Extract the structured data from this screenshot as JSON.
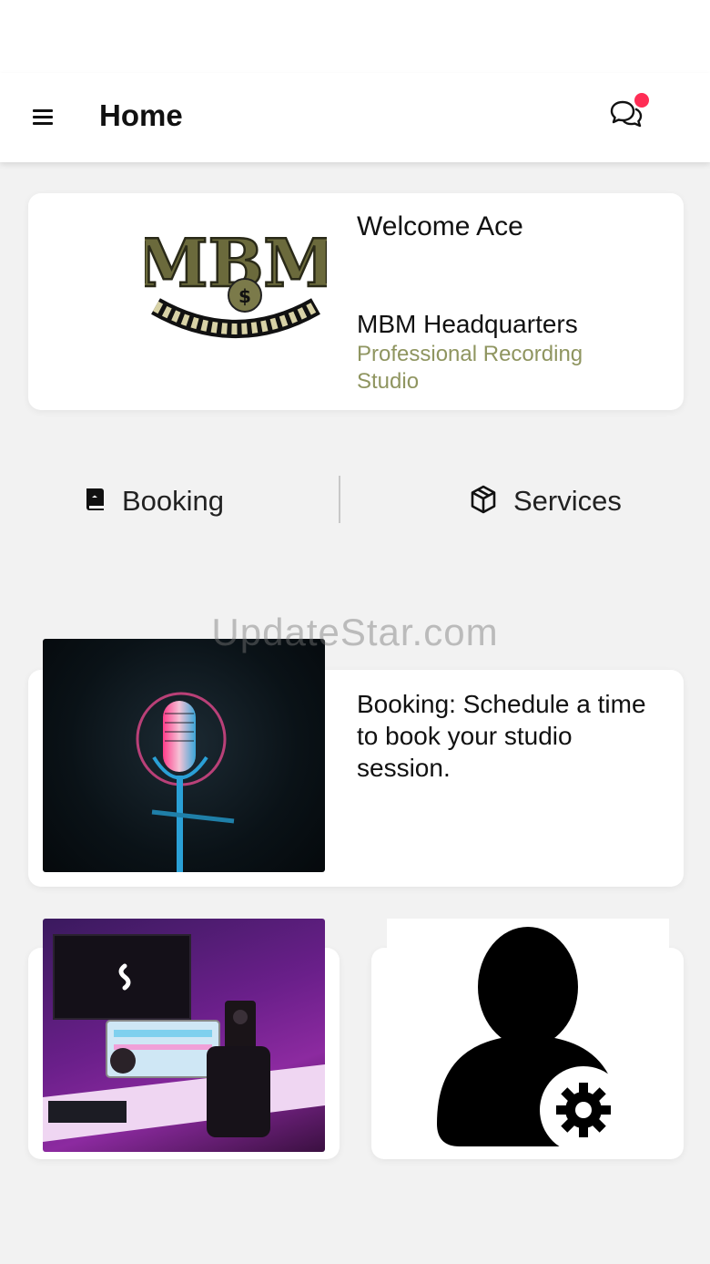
{
  "header": {
    "title": "Home",
    "menu_icon": "hamburger-menu-icon",
    "chat_icon": "chat-bubbles-icon",
    "notification_color": "#ff2d55"
  },
  "welcome": {
    "greeting": "Welcome Ace",
    "studio_name": "MBM Headquarters",
    "studio_subtitle": "Professional Recording Studio",
    "subtitle_color": "#8f9560",
    "logo_text": "MBM"
  },
  "quick_nav": {
    "booking_label": "Booking",
    "booking_icon": "book-icon",
    "services_label": "Services",
    "services_icon": "package-box-icon"
  },
  "watermark": "UpdateStar.com",
  "booking_card": {
    "description": "Booking: Schedule a time to book your studio session.",
    "image": "studio-microphone-photo"
  },
  "tiles": [
    {
      "image": "studio-workstation-photo"
    },
    {
      "image": "user-settings-icon"
    }
  ]
}
